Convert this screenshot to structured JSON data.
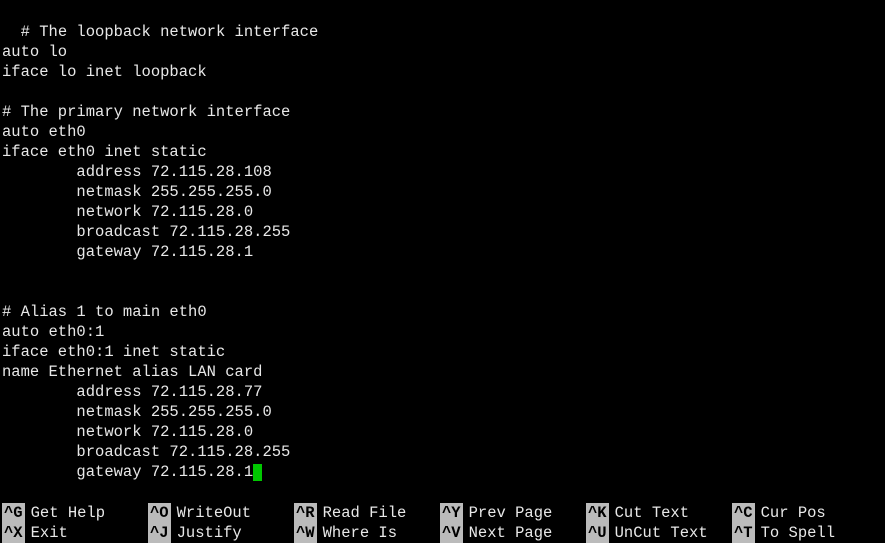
{
  "editor": {
    "lines": [
      "# The loopback network interface",
      "auto lo",
      "iface lo inet loopback",
      "",
      "# The primary network interface",
      "auto eth0",
      "iface eth0 inet static",
      "        address 72.115.28.108",
      "        netmask 255.255.255.0",
      "        network 72.115.28.0",
      "        broadcast 72.115.28.255",
      "        gateway 72.115.28.1",
      "",
      "",
      "# Alias 1 to main eth0",
      "auto eth0:1",
      "iface eth0:1 inet static",
      "name Ethernet alias LAN card",
      "        address 72.115.28.77",
      "        netmask 255.255.255.0",
      "        network 72.115.28.0",
      "        broadcast 72.115.28.255"
    ],
    "cursor_line_prefix": "        gateway 72.115.28.1"
  },
  "shortcuts": {
    "row1": [
      {
        "key": "^G",
        "label": "Get Help"
      },
      {
        "key": "^O",
        "label": "WriteOut"
      },
      {
        "key": "^R",
        "label": "Read File"
      },
      {
        "key": "^Y",
        "label": "Prev Page"
      },
      {
        "key": "^K",
        "label": "Cut Text"
      },
      {
        "key": "^C",
        "label": "Cur Pos"
      }
    ],
    "row2": [
      {
        "key": "^X",
        "label": "Exit"
      },
      {
        "key": "^J",
        "label": "Justify"
      },
      {
        "key": "^W",
        "label": "Where Is"
      },
      {
        "key": "^V",
        "label": "Next Page"
      },
      {
        "key": "^U",
        "label": "UnCut Text"
      },
      {
        "key": "^T",
        "label": "To Spell"
      }
    ]
  }
}
